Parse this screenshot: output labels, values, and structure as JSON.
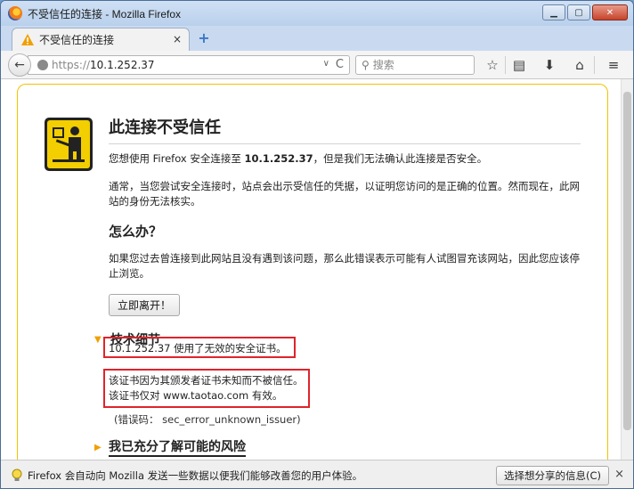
{
  "window": {
    "title": "不受信任的连接 - Mozilla Firefox",
    "controls": {
      "minimize": "▁",
      "maximize": "▢",
      "close": "✕"
    }
  },
  "tabs": [
    {
      "label": "不受信任的连接",
      "close": "×",
      "icon": "warning-icon"
    }
  ],
  "toolbar": {
    "new_tab": "+",
    "back": "←",
    "url_scheme": "https://",
    "url_host": "10.1.252.37",
    "url_dropdown": "∨",
    "reload": "C",
    "search_placeholder": "搜索",
    "icons": [
      "bookmark-star-icon",
      "reading-list-icon",
      "download-icon",
      "home-icon",
      "menu-icon"
    ]
  },
  "error_page": {
    "title": "此连接不受信任",
    "intro_prefix": "您想使用 Firefox 安全连接至 ",
    "intro_host": "10.1.252.37",
    "intro_suffix": "，但是我们无法确认此连接是否安全。",
    "explain": "通常，当您尝试安全连接时，站点会出示受信任的凭据，以证明您访问的是正确的位置。然而现在，此网站的身份无法核实。",
    "what_to_do_heading": "怎么办？",
    "what_to_do_text": "如果您过去曾连接到此网站且没有遇到该问题，那么此错误表示可能有人试图冒充该网站，因此您应该停止浏览。",
    "leave_button": "立即离开！",
    "tech_details_heading": "技术细节",
    "tech_arrow": "▼",
    "detail_line1": "10.1.252.37 使用了无效的安全证书。",
    "detail_line2": "该证书因为其颁发者证书未知而不被信任。",
    "detail_line3": "该证书仅对 www.taotao.com 有效。",
    "error_code": "(错误码： sec_error_unknown_issuer)",
    "risk_heading": "我已充分了解可能的风险",
    "risk_arrow": "▶"
  },
  "notification": {
    "message": "Firefox 会自动向 Mozilla 发送一些数据以便我们能够改善您的用户体验。",
    "button": "选择想分享的信息(C)",
    "close": "×"
  },
  "colors": {
    "accent_warning": "#f3ce00",
    "highlight_box": "#e0232b"
  }
}
